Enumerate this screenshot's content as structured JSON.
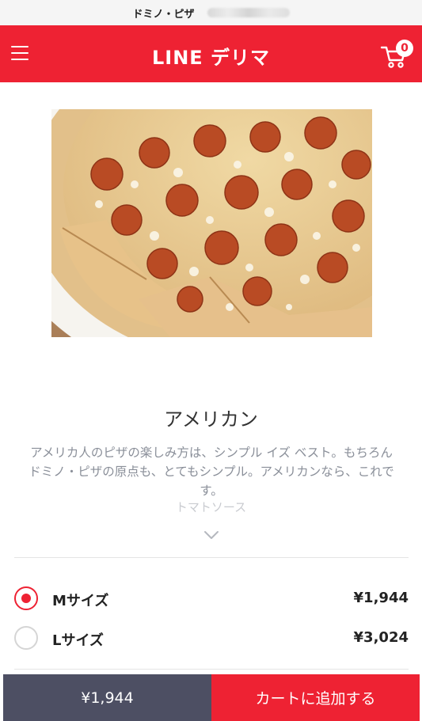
{
  "status": {
    "title": "ドミノ・ピザ"
  },
  "header": {
    "brand": "LINE デリマ",
    "menu_icon": "hamburger-menu-icon",
    "cart_icon": "shopping-cart-icon",
    "cart_count": "0"
  },
  "product": {
    "image": "pepperoni-pizza-photo",
    "name": "アメリカン",
    "description": "アメリカ人のピザの楽しみ方は、シンプル イズ ベスト。もちろんドミノ・ピザの原点も、とてもシンプル。アメリカンなら、これです。",
    "sauce": "トマトソース",
    "expand_icon": "chevron-down-icon"
  },
  "sizes": [
    {
      "label": "Mサイズ",
      "price": "¥1,944",
      "selected": true
    },
    {
      "label": "Lサイズ",
      "price": "¥3,024",
      "selected": false
    }
  ],
  "footer": {
    "total": "¥1,944",
    "add_button": "カートに追加する"
  },
  "colors": {
    "brand_red": "#ee2233",
    "footer_dark": "#4d4f63"
  }
}
